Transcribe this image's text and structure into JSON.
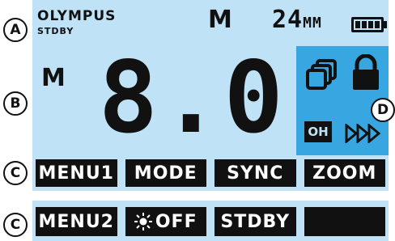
{
  "header": {
    "brand": "OLYMPUS",
    "status": "STDBY",
    "mode": "M",
    "zoom_value": "24",
    "zoom_unit": "MM",
    "battery_level_fraction": 1.0
  },
  "main": {
    "mode": "M",
    "power": "8.0"
  },
  "side_panel": {
    "icons": [
      "copy-icon",
      "lock-icon",
      "fast-forward-icon"
    ],
    "badge": "OH"
  },
  "softkeys_row1": {
    "keys": [
      "MENU1",
      "MODE",
      "SYNC",
      "ZOOM"
    ]
  },
  "softkeys_row2": {
    "keys": [
      "MENU2",
      "OFF",
      "STDBY",
      ""
    ]
  },
  "markers": {
    "a": "A",
    "b": "B",
    "c1": "C",
    "c2": "C",
    "d": "D"
  },
  "colors": {
    "lcd_background": "#bfe2f7",
    "side_panel": "#38a7e1",
    "key_background": "#111111",
    "key_text": "#ffffff"
  }
}
